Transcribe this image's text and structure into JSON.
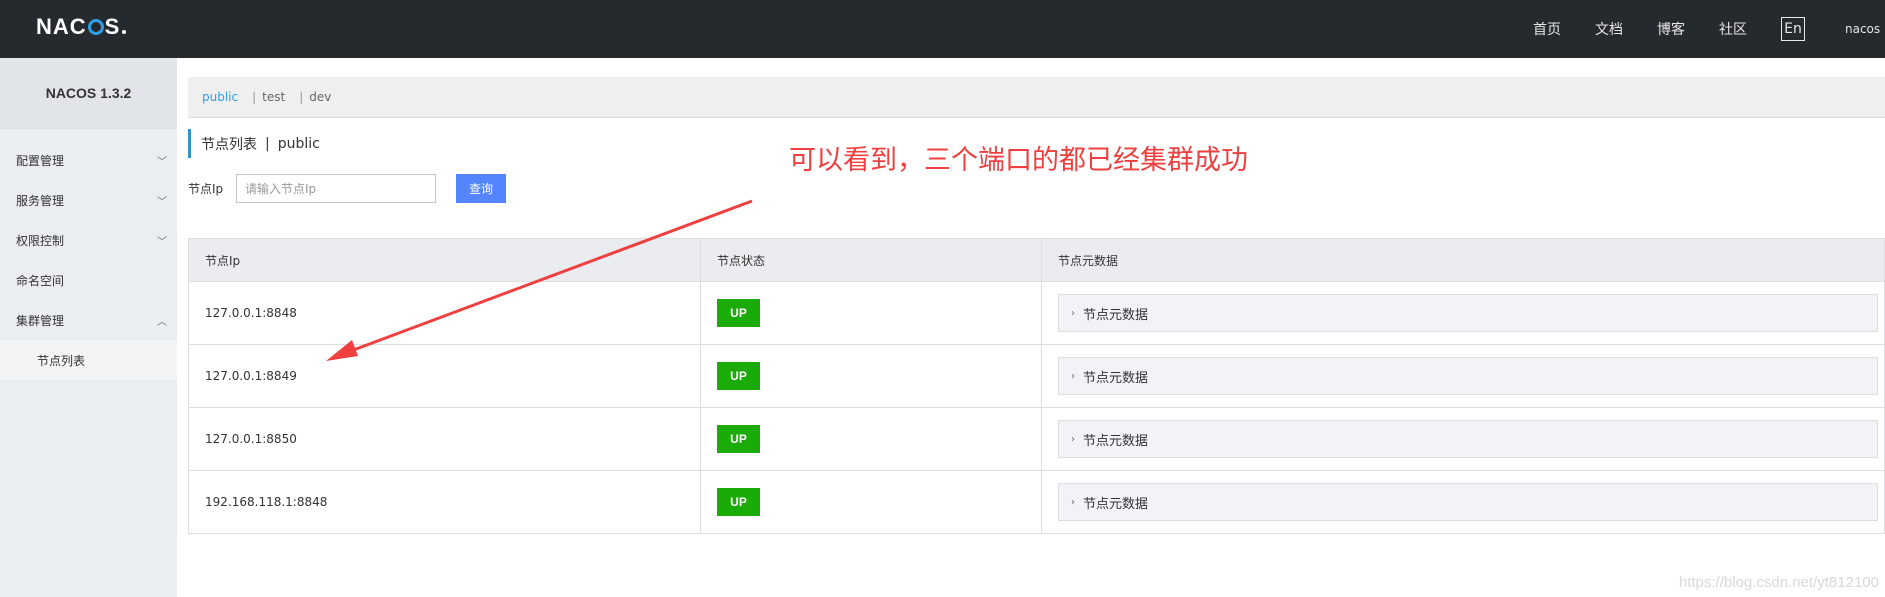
{
  "topbar": {
    "logo": "NACOS",
    "nav": [
      "首页",
      "文档",
      "博客",
      "社区"
    ],
    "lang_button": "En",
    "user": "nacos"
  },
  "sidebar": {
    "brand": "NACOS 1.3.2",
    "items": [
      {
        "label": "配置管理",
        "icon": "chevron-down-icon"
      },
      {
        "label": "服务管理",
        "icon": "chevron-down-icon"
      },
      {
        "label": "权限控制",
        "icon": "chevron-down-icon"
      },
      {
        "label": "命名空间",
        "icon": ""
      },
      {
        "label": "集群管理",
        "icon": "chevron-up-icon"
      }
    ],
    "subitems": [
      {
        "label": "节点列表"
      }
    ]
  },
  "namespaces": {
    "active": "public",
    "others": [
      "test",
      "dev"
    ],
    "separator": "|"
  },
  "page": {
    "title": "节点列表",
    "divider": "|",
    "namespace": "public"
  },
  "search": {
    "label": "节点Ip",
    "placeholder": "请输入节点Ip",
    "button": "查询"
  },
  "table": {
    "headers": [
      "节点Ip",
      "节点状态",
      "节点元数据"
    ],
    "rows": [
      {
        "ip": "127.0.0.1:8848",
        "status": "UP",
        "meta": "节点元数据"
      },
      {
        "ip": "127.0.0.1:8849",
        "status": "UP",
        "meta": "节点元数据"
      },
      {
        "ip": "127.0.0.1:8850",
        "status": "UP",
        "meta": "节点元数据"
      },
      {
        "ip": "192.168.118.1:8848",
        "status": "UP",
        "meta": "节点元数据"
      }
    ]
  },
  "annotation": {
    "text": "可以看到，三个端口的都已经集群成功",
    "color": "#ef3f3f"
  },
  "watermark": "https://blog.csdn.net/yt812100",
  "colors": {
    "topbar": "#252a2f",
    "accent": "#2f9fe8",
    "button": "#5584ff",
    "status_up": "#1aab06"
  }
}
